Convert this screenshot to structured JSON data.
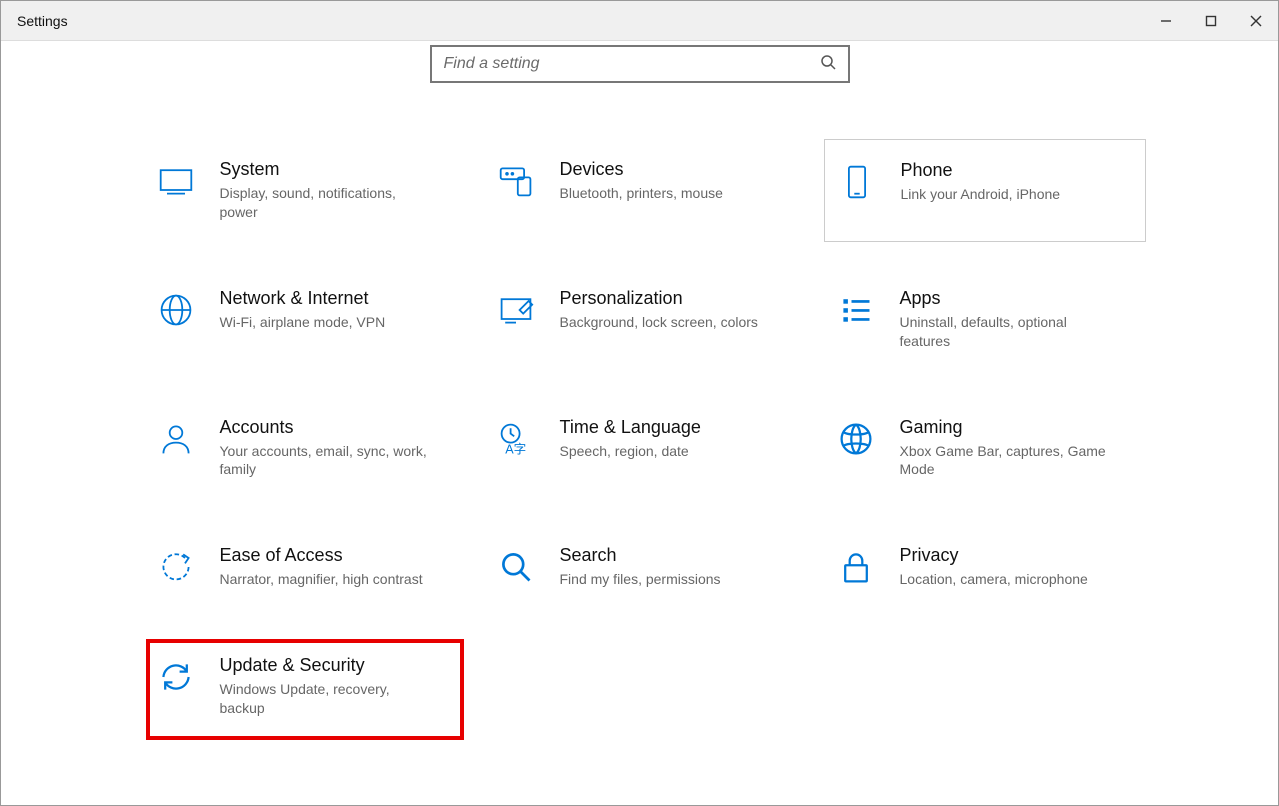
{
  "window": {
    "title": "Settings"
  },
  "search": {
    "placeholder": "Find a setting"
  },
  "categories": [
    {
      "id": "system",
      "title": "System",
      "desc": "Display, sound, notifications, power"
    },
    {
      "id": "devices",
      "title": "Devices",
      "desc": "Bluetooth, printers, mouse"
    },
    {
      "id": "phone",
      "title": "Phone",
      "desc": "Link your Android, iPhone",
      "hover": true
    },
    {
      "id": "network",
      "title": "Network & Internet",
      "desc": "Wi-Fi, airplane mode, VPN"
    },
    {
      "id": "personalization",
      "title": "Personalization",
      "desc": "Background, lock screen, colors"
    },
    {
      "id": "apps",
      "title": "Apps",
      "desc": "Uninstall, defaults, optional features"
    },
    {
      "id": "accounts",
      "title": "Accounts",
      "desc": "Your accounts, email, sync, work, family"
    },
    {
      "id": "time",
      "title": "Time & Language",
      "desc": "Speech, region, date"
    },
    {
      "id": "gaming",
      "title": "Gaming",
      "desc": "Xbox Game Bar, captures, Game Mode"
    },
    {
      "id": "ease",
      "title": "Ease of Access",
      "desc": "Narrator, magnifier, high contrast"
    },
    {
      "id": "search",
      "title": "Search",
      "desc": "Find my files, permissions"
    },
    {
      "id": "privacy",
      "title": "Privacy",
      "desc": "Location, camera, microphone"
    },
    {
      "id": "update",
      "title": "Update & Security",
      "desc": "Windows Update, recovery, backup",
      "highlight": true
    }
  ]
}
